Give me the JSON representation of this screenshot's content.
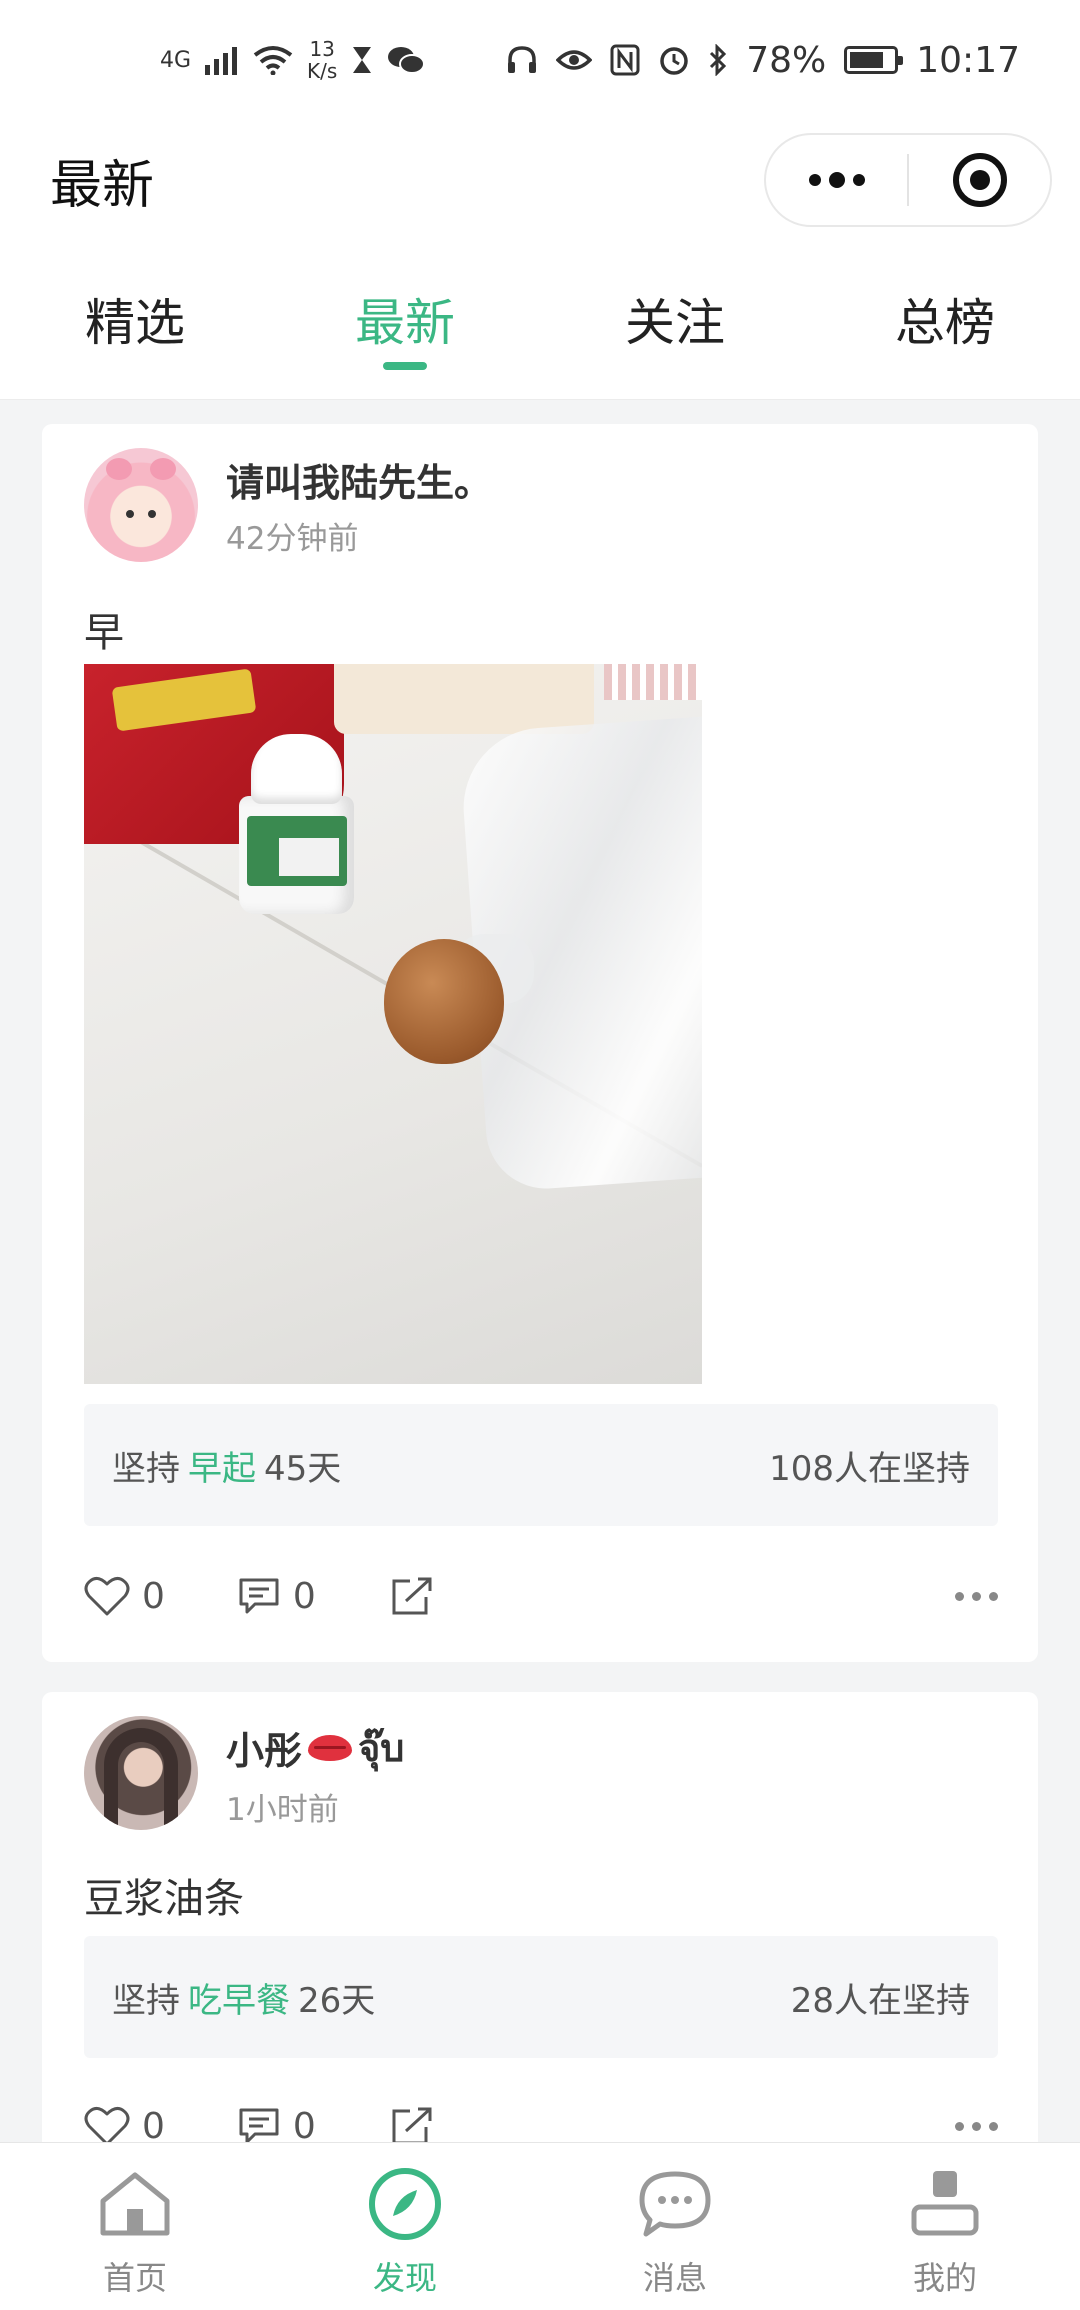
{
  "status_bar": {
    "network": "4G",
    "speed_value": "13",
    "speed_unit": "K/s",
    "battery_pct": "78%",
    "battery_level": 0.78,
    "time": "10:17"
  },
  "header": {
    "title": "最新"
  },
  "tabs": [
    {
      "label": "精选",
      "active": false
    },
    {
      "label": "最新",
      "active": true
    },
    {
      "label": "关注",
      "active": false
    },
    {
      "label": "总榜",
      "active": false
    }
  ],
  "posts": [
    {
      "username": "请叫我陆先生。",
      "time_ago": "42分钟前",
      "text": "早",
      "streak": {
        "prefix": "坚持",
        "habit": "早起",
        "days": "45天",
        "participants": "108人在坚持"
      },
      "likes": "0",
      "comments": "0"
    },
    {
      "username": "小彤",
      "username_suffix": "จุ๊บ",
      "time_ago": "1小时前",
      "text": "豆浆油条",
      "streak": {
        "prefix": "坚持",
        "habit": "吃早餐",
        "days": "26天",
        "participants": "28人在坚持"
      },
      "likes": "0",
      "comments": "0"
    }
  ],
  "bottom_nav": [
    {
      "label": "首页",
      "icon": "home-icon",
      "active": false
    },
    {
      "label": "发现",
      "icon": "discover-icon",
      "active": true
    },
    {
      "label": "消息",
      "icon": "message-icon",
      "active": false
    },
    {
      "label": "我的",
      "icon": "profile-icon",
      "active": false
    }
  ],
  "colors": {
    "accent": "#3bb784",
    "background": "#f3f4f5",
    "text": "#333333"
  }
}
